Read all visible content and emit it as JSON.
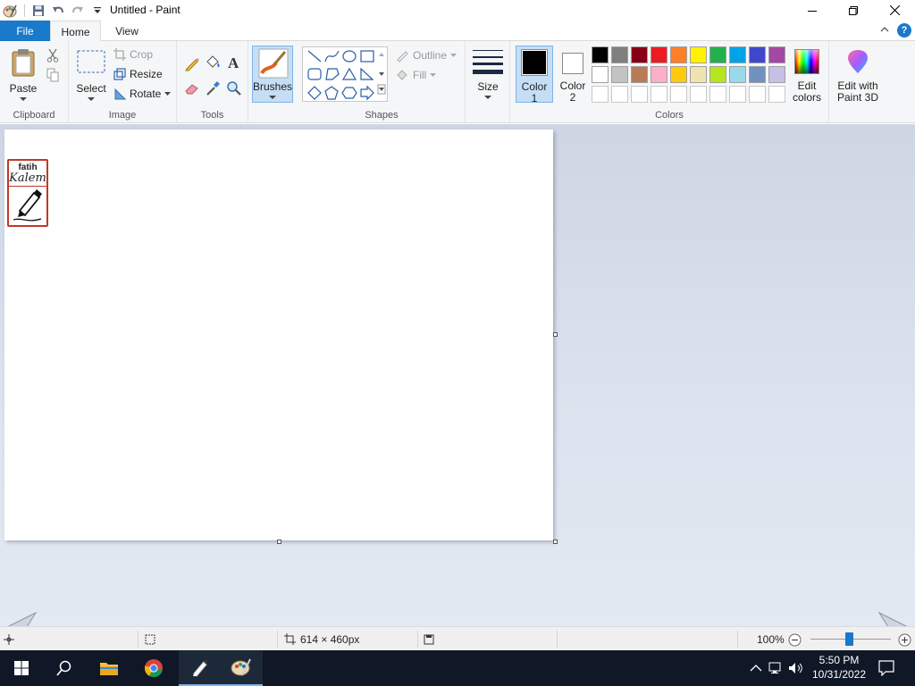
{
  "window": {
    "title": "Untitled - Paint"
  },
  "tabs": {
    "file": "File",
    "home": "Home",
    "view": "View"
  },
  "ribbon": {
    "clipboard": {
      "group_label": "Clipboard",
      "paste_label": "Paste"
    },
    "image": {
      "group_label": "Image",
      "select_label": "Select",
      "crop_label": "Crop",
      "resize_label": "Resize",
      "rotate_label": "Rotate"
    },
    "tools": {
      "group_label": "Tools"
    },
    "brushes": {
      "label": "Brushes"
    },
    "shapes": {
      "group_label": "Shapes",
      "outline_label": "Outline",
      "fill_label": "Fill"
    },
    "size": {
      "label": "Size"
    },
    "colors": {
      "group_label": "Colors",
      "color1_label": "Color",
      "color1_num": "1",
      "color2_label": "Color",
      "color2_num": "2",
      "edit_colors_line1": "Edit",
      "edit_colors_line2": "colors",
      "paint3d_line1": "Edit with",
      "paint3d_line2": "Paint 3D",
      "color1_value": "#000000",
      "color2_value": "#ffffff",
      "palette_row1": [
        "#000000",
        "#7f7f7f",
        "#880015",
        "#ed1c24",
        "#ff7f27",
        "#fff200",
        "#22b14c",
        "#00a2e8",
        "#3f48cc",
        "#a349a4"
      ],
      "palette_row2": [
        "#ffffff",
        "#c3c3c3",
        "#b97a57",
        "#ffaec9",
        "#ffc90e",
        "#efe4b0",
        "#b5e61d",
        "#99d9ea",
        "#7092be",
        "#c8bfe7"
      ],
      "palette_row3": [
        "#ffffff",
        "#ffffff",
        "#ffffff",
        "#ffffff",
        "#ffffff",
        "#ffffff",
        "#ffffff",
        "#ffffff",
        "#ffffff",
        "#ffffff"
      ]
    }
  },
  "canvas": {
    "sticker_top": "fatih",
    "sticker_script": "Kalem"
  },
  "status": {
    "dimensions": "614 × 460px",
    "zoom": "100%"
  },
  "taskbar": {
    "time": "5:50 PM",
    "date": "10/31/2022"
  }
}
